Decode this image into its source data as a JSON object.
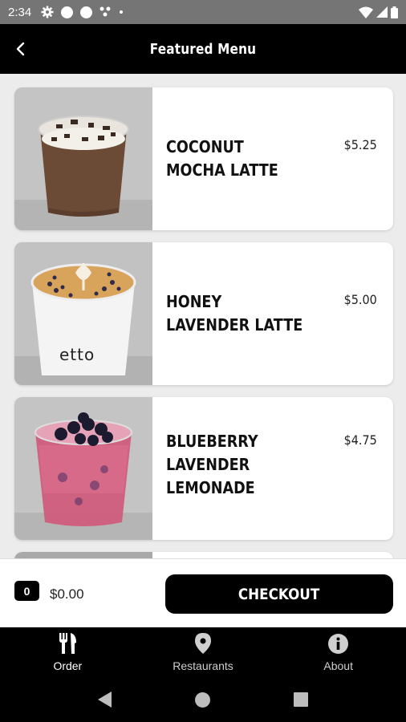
{
  "status_bar": {
    "time": "2:34"
  },
  "app_bar": {
    "title": "Featured Menu"
  },
  "menu_items": [
    {
      "name": "COCONUT MOCHA LATTE",
      "price": "$5.25"
    },
    {
      "name": "HONEY LAVENDER LATTE",
      "price": "$5.00",
      "cup_brand": "etto"
    },
    {
      "name": "BLUEBERRY LAVENDER LEMONADE",
      "price": "$4.75"
    }
  ],
  "cart": {
    "count": "0",
    "total": "$0.00",
    "checkout_label": "CHECKOUT"
  },
  "tabs": [
    {
      "label": "Order",
      "icon": "utensils-icon",
      "active": true
    },
    {
      "label": "Restaurants",
      "icon": "map-pin-icon",
      "active": false
    },
    {
      "label": "About",
      "icon": "info-icon",
      "active": false
    }
  ],
  "colors": {
    "bar": "#000000",
    "card": "#ffffff",
    "background": "#ececec",
    "status_bar": "#757575"
  }
}
